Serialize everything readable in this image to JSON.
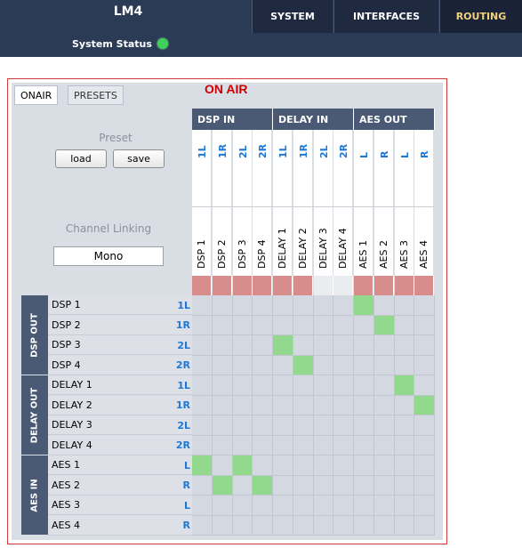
{
  "header": {
    "device": "LM4",
    "nav": [
      "SYSTEM",
      "INTERFACES",
      "ROUTING"
    ],
    "active_nav": "ROUTING",
    "status_label": "System Status",
    "status_color": "#3ecf5a"
  },
  "tabs": [
    "ONAIR",
    "PRESETS"
  ],
  "title": "ON AIR",
  "preset": {
    "label": "Preset",
    "load": "load",
    "save": "save"
  },
  "linking": {
    "label": "Channel Linking",
    "value": "Mono"
  },
  "col_groups": [
    {
      "label": "DSP IN",
      "columns": [
        {
          "short": "1L",
          "name": "DSP 1",
          "status": "red"
        },
        {
          "short": "1R",
          "name": "DSP 2",
          "status": "red"
        },
        {
          "short": "2L",
          "name": "DSP 3",
          "status": "red"
        },
        {
          "short": "2R",
          "name": "DSP 4",
          "status": "red"
        }
      ]
    },
    {
      "label": "DELAY IN",
      "columns": [
        {
          "short": "1L",
          "name": "DELAY 1",
          "status": "red"
        },
        {
          "short": "1R",
          "name": "DELAY 2",
          "status": "red"
        },
        {
          "short": "2L",
          "name": "DELAY 3",
          "status": "none"
        },
        {
          "short": "2R",
          "name": "DELAY 4",
          "status": "none"
        }
      ]
    },
    {
      "label": "AES OUT",
      "columns": [
        {
          "short": "L",
          "name": "AES 1",
          "status": "red"
        },
        {
          "short": "R",
          "name": "AES 2",
          "status": "red"
        },
        {
          "short": "L",
          "name": "AES 3",
          "status": "red"
        },
        {
          "short": "R",
          "name": "AES 4",
          "status": "red"
        }
      ]
    }
  ],
  "row_groups": [
    {
      "label": "DSP OUT",
      "rows": [
        {
          "name": "DSP 1",
          "short": "1L"
        },
        {
          "name": "DSP 2",
          "short": "1R"
        },
        {
          "name": "DSP 3",
          "short": "2L"
        },
        {
          "name": "DSP 4",
          "short": "2R"
        }
      ]
    },
    {
      "label": "DELAY OUT",
      "rows": [
        {
          "name": "DELAY 1",
          "short": "1L"
        },
        {
          "name": "DELAY 2",
          "short": "1R"
        },
        {
          "name": "DELAY 3",
          "short": "2L"
        },
        {
          "name": "DELAY 4",
          "short": "2R"
        }
      ]
    },
    {
      "label": "AES IN",
      "rows": [
        {
          "name": "AES 1",
          "short": "L"
        },
        {
          "name": "AES 2",
          "short": "R"
        },
        {
          "name": "AES 3",
          "short": "L"
        },
        {
          "name": "AES 4",
          "short": "R"
        }
      ]
    }
  ],
  "routes": [
    [
      0,
      8
    ],
    [
      1,
      9
    ],
    [
      2,
      4
    ],
    [
      3,
      5
    ],
    [
      4,
      10
    ],
    [
      5,
      11
    ],
    [
      8,
      0
    ],
    [
      8,
      2
    ],
    [
      9,
      1
    ],
    [
      9,
      3
    ]
  ]
}
